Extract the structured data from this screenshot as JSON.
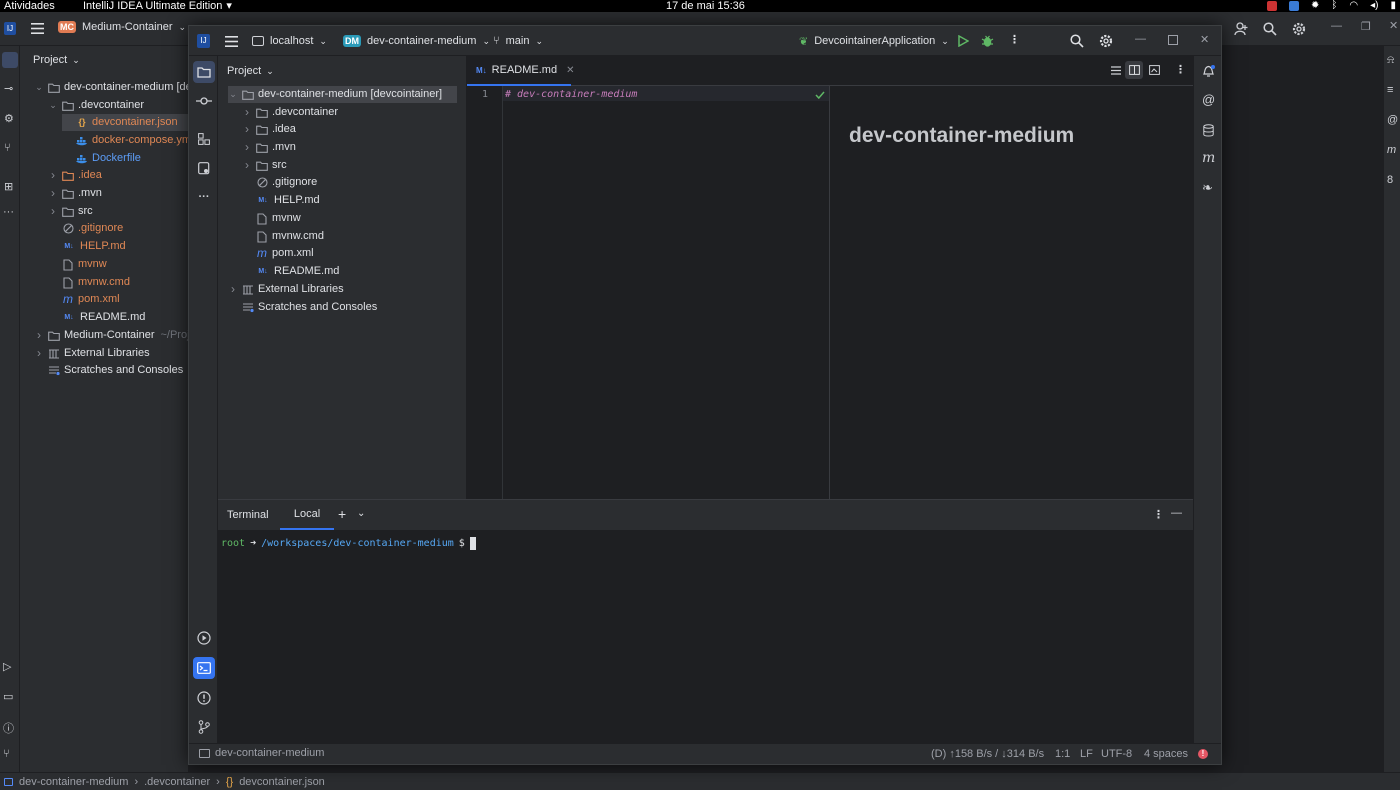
{
  "system": {
    "activities": "Atividades",
    "app_name": "IntelliJ IDEA Ultimate Edition",
    "datetime": "17 de mai  15:36"
  },
  "background_ide": {
    "project_badge": "MC",
    "project_name": "Medium-Container",
    "panel_title": "Project",
    "tree": [
      {
        "label": "dev-container-medium [de",
        "icon": "folder-icon"
      },
      {
        "label": ".devcontainer",
        "icon": "folder-icon"
      },
      {
        "label": "devcontainer.json",
        "icon": "json-icon"
      },
      {
        "label": "docker-compose.ym",
        "icon": "docker-icon"
      },
      {
        "label": "Dockerfile",
        "icon": "docker-icon"
      },
      {
        "label": ".idea",
        "icon": "folder-icon"
      },
      {
        "label": ".mvn",
        "icon": "folder-icon"
      },
      {
        "label": "src",
        "icon": "folder-icon"
      },
      {
        "label": ".gitignore",
        "icon": "ignore-icon"
      },
      {
        "label": "HELP.md",
        "icon": "markdown-icon"
      },
      {
        "label": "mvnw",
        "icon": "file-icon"
      },
      {
        "label": "mvnw.cmd",
        "icon": "file-icon"
      },
      {
        "label": "pom.xml",
        "icon": "maven-icon"
      },
      {
        "label": "README.md",
        "icon": "markdown-icon"
      },
      {
        "label": "Medium-Container",
        "icon": "folder-icon",
        "suffix": "~/Proje"
      },
      {
        "label": "External Libraries",
        "icon": "library-icon"
      },
      {
        "label": "Scratches and Consoles",
        "icon": "scratches-icon"
      }
    ],
    "breadcrumb": [
      "dev-container-medium",
      ".devcontainer",
      "devcontainer.json"
    ]
  },
  "header": {
    "host": "localhost",
    "project_badge": "DM",
    "project_name": "dev-container-medium",
    "branch": "main",
    "run_config": "DevcointainerApplication"
  },
  "project_panel": {
    "title": "Project",
    "tree": [
      {
        "label": "dev-container-medium [devcointainer]",
        "icon": "folder-icon"
      },
      {
        "label": ".devcontainer",
        "icon": "folder-icon"
      },
      {
        "label": ".idea",
        "icon": "folder-icon"
      },
      {
        "label": ".mvn",
        "icon": "folder-icon"
      },
      {
        "label": "src",
        "icon": "folder-icon"
      },
      {
        "label": ".gitignore",
        "icon": "ignore-icon"
      },
      {
        "label": "HELP.md",
        "icon": "markdown-icon"
      },
      {
        "label": "mvnw",
        "icon": "file-icon"
      },
      {
        "label": "mvnw.cmd",
        "icon": "file-icon"
      },
      {
        "label": "pom.xml",
        "icon": "maven-icon"
      },
      {
        "label": "README.md",
        "icon": "markdown-icon"
      },
      {
        "label": "External Libraries",
        "icon": "library-icon"
      },
      {
        "label": "Scratches and Consoles",
        "icon": "scratches-icon"
      }
    ]
  },
  "editor": {
    "tab_label": "README.md",
    "line_number": "1",
    "line_text": "# dev-container-medium",
    "preview_heading": "dev-container-medium"
  },
  "terminal": {
    "title": "Terminal",
    "tab_label": "Local",
    "prompt_user": "root",
    "prompt_arrow": "➜",
    "prompt_path": "/workspaces/dev-container-medium",
    "prompt_symbol": "$"
  },
  "status": {
    "project": "dev-container-medium",
    "network": "(D) ↑158 B/s / ↓314 B/s",
    "position": "1:1",
    "line_ending": "LF",
    "encoding": "UTF-8",
    "indent": "4 spaces"
  },
  "colors": {
    "accent": "#3574f0",
    "error": "#e55765",
    "run": "#5fb865",
    "orange_file": "#e08855",
    "blue_file": "#5c9cf5"
  }
}
